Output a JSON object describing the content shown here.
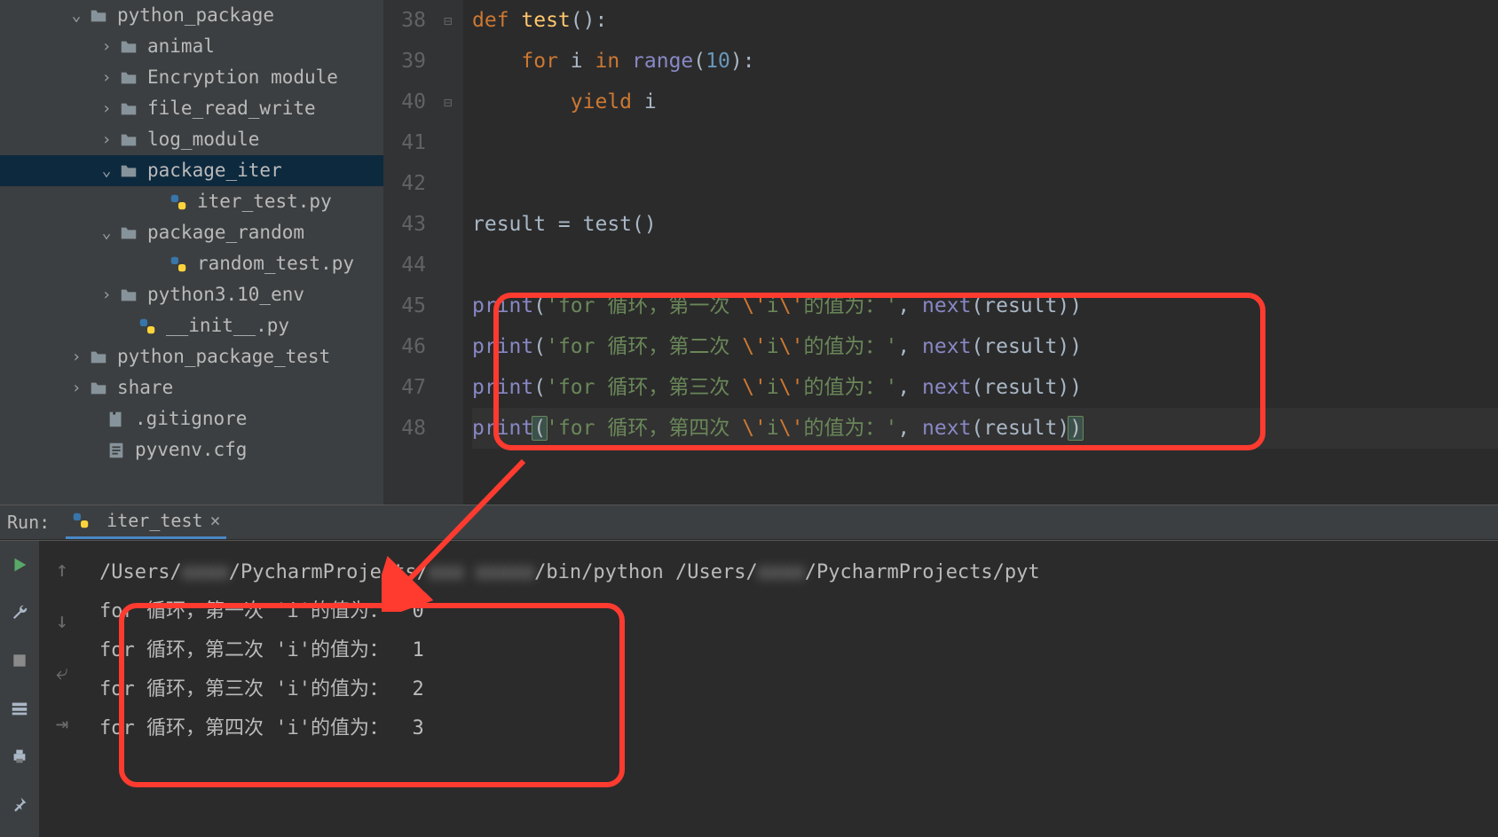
{
  "sidebar": {
    "tree": [
      {
        "indent": 78,
        "chevron": "down",
        "icon": "folder",
        "label": "python_package",
        "sel": false
      },
      {
        "indent": 112,
        "chevron": "right",
        "icon": "folder",
        "label": "animal",
        "sel": false
      },
      {
        "indent": 112,
        "chevron": "right",
        "icon": "folder",
        "label": "Encryption module",
        "sel": false
      },
      {
        "indent": 112,
        "chevron": "right",
        "icon": "folder",
        "label": "file_read_write",
        "sel": false
      },
      {
        "indent": 112,
        "chevron": "right",
        "icon": "folder",
        "label": "log_module",
        "sel": false
      },
      {
        "indent": 112,
        "chevron": "down",
        "icon": "folder",
        "label": "package_iter",
        "sel": true
      },
      {
        "indent": 168,
        "chevron": "blank",
        "icon": "py",
        "label": "iter_test.py",
        "sel": false
      },
      {
        "indent": 112,
        "chevron": "down",
        "icon": "folder",
        "label": "package_random",
        "sel": false
      },
      {
        "indent": 168,
        "chevron": "blank",
        "icon": "py",
        "label": "random_test.py",
        "sel": false
      },
      {
        "indent": 112,
        "chevron": "right",
        "icon": "folder",
        "label": "python3.10_env",
        "sel": false
      },
      {
        "indent": 133,
        "chevron": "blank",
        "icon": "py",
        "label": "__init__.py",
        "sel": false
      },
      {
        "indent": 78,
        "chevron": "right",
        "icon": "folder-test",
        "label": "python_package_test",
        "sel": false
      },
      {
        "indent": 78,
        "chevron": "right",
        "icon": "folder",
        "label": "share",
        "sel": false
      },
      {
        "indent": 98,
        "chevron": "blank",
        "icon": "gitignore",
        "label": ".gitignore",
        "sel": false
      },
      {
        "indent": 98,
        "chevron": "blank",
        "icon": "cfg",
        "label": "pyvenv.cfg",
        "sel": false
      }
    ]
  },
  "editor": {
    "lines": [
      {
        "n": 38,
        "tokens": [
          {
            "c": "kw",
            "t": "def "
          },
          {
            "c": "fn",
            "t": "test"
          },
          {
            "c": "pn",
            "t": "():"
          }
        ]
      },
      {
        "n": 39,
        "tokens": [
          {
            "c": "pn",
            "t": "    "
          },
          {
            "c": "kw",
            "t": "for "
          },
          {
            "c": "id",
            "t": "i "
          },
          {
            "c": "kw",
            "t": "in "
          },
          {
            "c": "builtin",
            "t": "range"
          },
          {
            "c": "pn",
            "t": "("
          },
          {
            "c": "num",
            "t": "10"
          },
          {
            "c": "pn",
            "t": "):"
          }
        ]
      },
      {
        "n": 40,
        "tokens": [
          {
            "c": "pn",
            "t": "        "
          },
          {
            "c": "kw",
            "t": "yield "
          },
          {
            "c": "id",
            "t": "i"
          }
        ]
      },
      {
        "n": 41,
        "tokens": []
      },
      {
        "n": 42,
        "tokens": []
      },
      {
        "n": 43,
        "tokens": [
          {
            "c": "id",
            "t": "result = test()"
          }
        ]
      },
      {
        "n": 44,
        "tokens": []
      },
      {
        "n": 45,
        "tokens": [
          {
            "c": "builtin",
            "t": "print"
          },
          {
            "c": "pn",
            "t": "("
          },
          {
            "c": "str",
            "t": "'for 循环，第一次 "
          },
          {
            "c": "esc",
            "t": "\\'"
          },
          {
            "c": "str",
            "t": "i"
          },
          {
            "c": "esc",
            "t": "\\'"
          },
          {
            "c": "str",
            "t": "的值为：'"
          },
          {
            "c": "pn",
            "t": ", "
          },
          {
            "c": "builtin",
            "t": "next"
          },
          {
            "c": "pn",
            "t": "(result))"
          }
        ]
      },
      {
        "n": 46,
        "tokens": [
          {
            "c": "builtin",
            "t": "print"
          },
          {
            "c": "pn",
            "t": "("
          },
          {
            "c": "str",
            "t": "'for 循环，第二次 "
          },
          {
            "c": "esc",
            "t": "\\'"
          },
          {
            "c": "str",
            "t": "i"
          },
          {
            "c": "esc",
            "t": "\\'"
          },
          {
            "c": "str",
            "t": "的值为：'"
          },
          {
            "c": "pn",
            "t": ", "
          },
          {
            "c": "builtin",
            "t": "next"
          },
          {
            "c": "pn",
            "t": "(result))"
          }
        ]
      },
      {
        "n": 47,
        "tokens": [
          {
            "c": "builtin",
            "t": "print"
          },
          {
            "c": "pn",
            "t": "("
          },
          {
            "c": "str",
            "t": "'for 循环，第三次 "
          },
          {
            "c": "esc",
            "t": "\\'"
          },
          {
            "c": "str",
            "t": "i"
          },
          {
            "c": "esc",
            "t": "\\'"
          },
          {
            "c": "str",
            "t": "的值为：'"
          },
          {
            "c": "pn",
            "t": ", "
          },
          {
            "c": "builtin",
            "t": "next"
          },
          {
            "c": "pn",
            "t": "(result))"
          }
        ]
      },
      {
        "n": 48,
        "hl": true,
        "tokens": [
          {
            "c": "builtin",
            "t": "print"
          },
          {
            "c": "paren-match",
            "t": "("
          },
          {
            "c": "str",
            "t": "'for 循环，第四次 "
          },
          {
            "c": "esc",
            "t": "\\'"
          },
          {
            "c": "str",
            "t": "i"
          },
          {
            "c": "esc",
            "t": "\\'"
          },
          {
            "c": "str",
            "t": "的值为：'"
          },
          {
            "c": "pn",
            "t": ", "
          },
          {
            "c": "builtin",
            "t": "next"
          },
          {
            "c": "pn",
            "t": "(result)"
          },
          {
            "c": "paren-match",
            "t": ")"
          }
        ]
      }
    ]
  },
  "run": {
    "label": "Run:",
    "tab_name": "iter_test",
    "cmd_visible_parts": [
      "/Users/",
      "/PycharmProjects/",
      "/bin/python /Users/",
      "/PycharmProjects/pyt"
    ],
    "cmd_blur_parts": [
      "xxxx",
      "xxx xxxxx",
      "xxxx"
    ],
    "output_lines": [
      "for 循环，第一次 'i'的值为：  0",
      "for 循环，第二次 'i'的值为：  1",
      "for 循环，第三次 'i'的值为：  2",
      "for 循环，第四次 'i'的值为：  3"
    ]
  },
  "icons": {
    "play": "▶",
    "wrench": "🔧",
    "stop": "■",
    "layout": "≣",
    "printer": "🖶",
    "pin": "📌",
    "up": "↑",
    "down": "↓",
    "wrap": "↩",
    "stepret": "⇥"
  }
}
